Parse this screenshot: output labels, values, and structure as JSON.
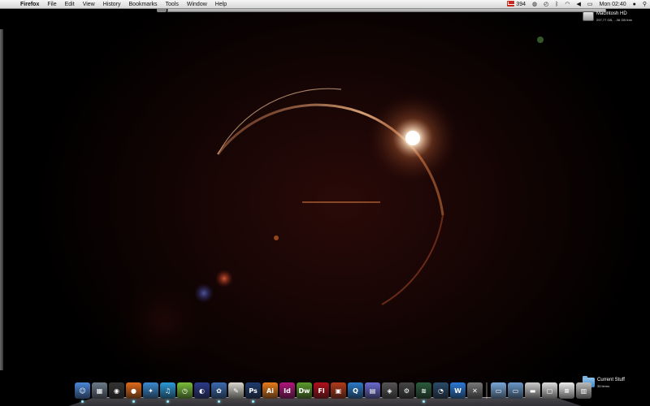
{
  "menubar": {
    "apple_symbol": "",
    "items": [
      "Firefox",
      "File",
      "Edit",
      "View",
      "History",
      "Bookmarks",
      "Tools",
      "Window",
      "Help"
    ],
    "status": {
      "mail_count": "394",
      "clock": "Mon 02:40"
    }
  },
  "desktop": {
    "hd": {
      "name": "Macintosh HD",
      "info": "297.77 GB, ...36 GB free"
    },
    "folder": {
      "name": "Current Stuff",
      "info": "35 items"
    }
  },
  "dock": {
    "apps": [
      {
        "icon": "finder-icon",
        "glyph": "☺",
        "color": "#4a86d8"
      },
      {
        "icon": "expose-icon",
        "glyph": "▦",
        "color": "#6a7a8a"
      },
      {
        "icon": "dashboard-icon",
        "glyph": "◉",
        "color": "#333"
      },
      {
        "icon": "firefox-icon",
        "glyph": "●",
        "color": "#e06a18"
      },
      {
        "icon": "safari-icon",
        "glyph": "✦",
        "color": "#3a8ad0"
      },
      {
        "icon": "itunes-icon",
        "glyph": "♫",
        "color": "#2a9ad8"
      },
      {
        "icon": "clock-icon",
        "glyph": "◷",
        "color": "#7abf3a"
      },
      {
        "icon": "orb-icon",
        "glyph": "◐",
        "color": "#2b3a8a"
      },
      {
        "icon": "adium-icon",
        "glyph": "✿",
        "color": "#3a6ab0"
      },
      {
        "icon": "notes-icon",
        "glyph": "✎",
        "color": "#d8d8d0"
      },
      {
        "icon": "photoshop-icon",
        "glyph": "Ps",
        "color": "#1e3b6e"
      },
      {
        "icon": "illustrator-icon",
        "glyph": "Ai",
        "color": "#e87c1a"
      },
      {
        "icon": "indesign-icon",
        "glyph": "Id",
        "color": "#b0157a"
      },
      {
        "icon": "dreamweaver-icon",
        "glyph": "Dw",
        "color": "#5a9a2a"
      },
      {
        "icon": "flash-icon",
        "glyph": "Fl",
        "color": "#b0101a"
      },
      {
        "icon": "photo-icon",
        "glyph": "▣",
        "color": "#b03a1a"
      },
      {
        "icon": "quicktime-icon",
        "glyph": "Q",
        "color": "#2a7ac8"
      },
      {
        "icon": "stack-icon",
        "glyph": "▤",
        "color": "#6a6ad0"
      },
      {
        "icon": "acrobat-icon",
        "glyph": "◈",
        "color": "#555"
      },
      {
        "icon": "utility-icon",
        "glyph": "⚙",
        "color": "#444"
      },
      {
        "icon": "activity-monitor-icon",
        "glyph": "≋",
        "color": "#2a5a3a"
      },
      {
        "icon": "time-machine-icon",
        "glyph": "◔",
        "color": "#2a4a6a"
      },
      {
        "icon": "wunderlist-icon",
        "glyph": "W",
        "color": "#2a7ad8"
      },
      {
        "icon": "tools-icon",
        "glyph": "✕",
        "color": "#777"
      }
    ],
    "docs": [
      {
        "icon": "applications-folder-icon",
        "glyph": "▭",
        "color": "#7aa8d8"
      },
      {
        "icon": "documents-folder-icon",
        "glyph": "▭",
        "color": "#6a98c8"
      },
      {
        "icon": "drive-icon",
        "glyph": "▬",
        "color": "#ccc"
      },
      {
        "icon": "picture-doc-icon",
        "glyph": "▢",
        "color": "#ddd"
      },
      {
        "icon": "text-doc-icon",
        "glyph": "≡",
        "color": "#eee"
      },
      {
        "icon": "trash-icon",
        "glyph": "▥",
        "color": "#bbb"
      }
    ]
  }
}
